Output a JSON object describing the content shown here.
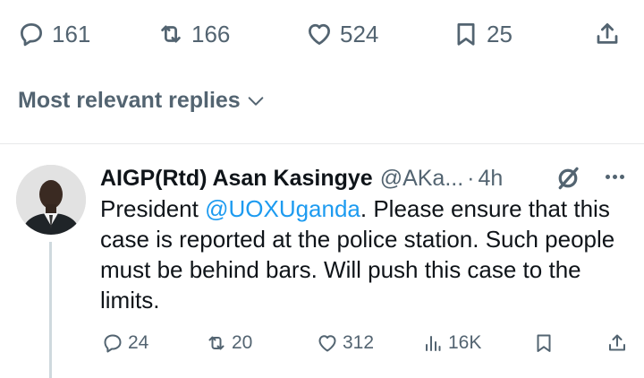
{
  "tweet_actions": {
    "replies": "161",
    "retweets": "166",
    "likes": "524",
    "bookmarks": "25"
  },
  "sort": {
    "label": "Most relevant replies"
  },
  "reply": {
    "author_name": "AIGP(Rtd) Asan Kasingye",
    "handle": "@AKa...",
    "dot": "·",
    "time": "4h",
    "text_before": "President ",
    "mention": "@UOXUganda",
    "text_after": ". Please ensure that this case is reported at the police station. Such people must be behind bars. Will push this case to the limits.",
    "actions": {
      "replies": "24",
      "retweets": "20",
      "likes": "312",
      "views": "16K"
    }
  },
  "icons": {
    "reply": "reply-icon",
    "retweet": "retweet-icon",
    "like": "heart-icon",
    "bookmark": "bookmark-icon",
    "share": "share-icon",
    "views": "views-icon",
    "grok": "grok-icon",
    "more": "more-icon",
    "sort": "chevron-down-icon"
  },
  "colors": {
    "text": "#0f1419",
    "muted": "#536471",
    "link": "#1d9bf0",
    "divider": "#e7e9ea"
  }
}
